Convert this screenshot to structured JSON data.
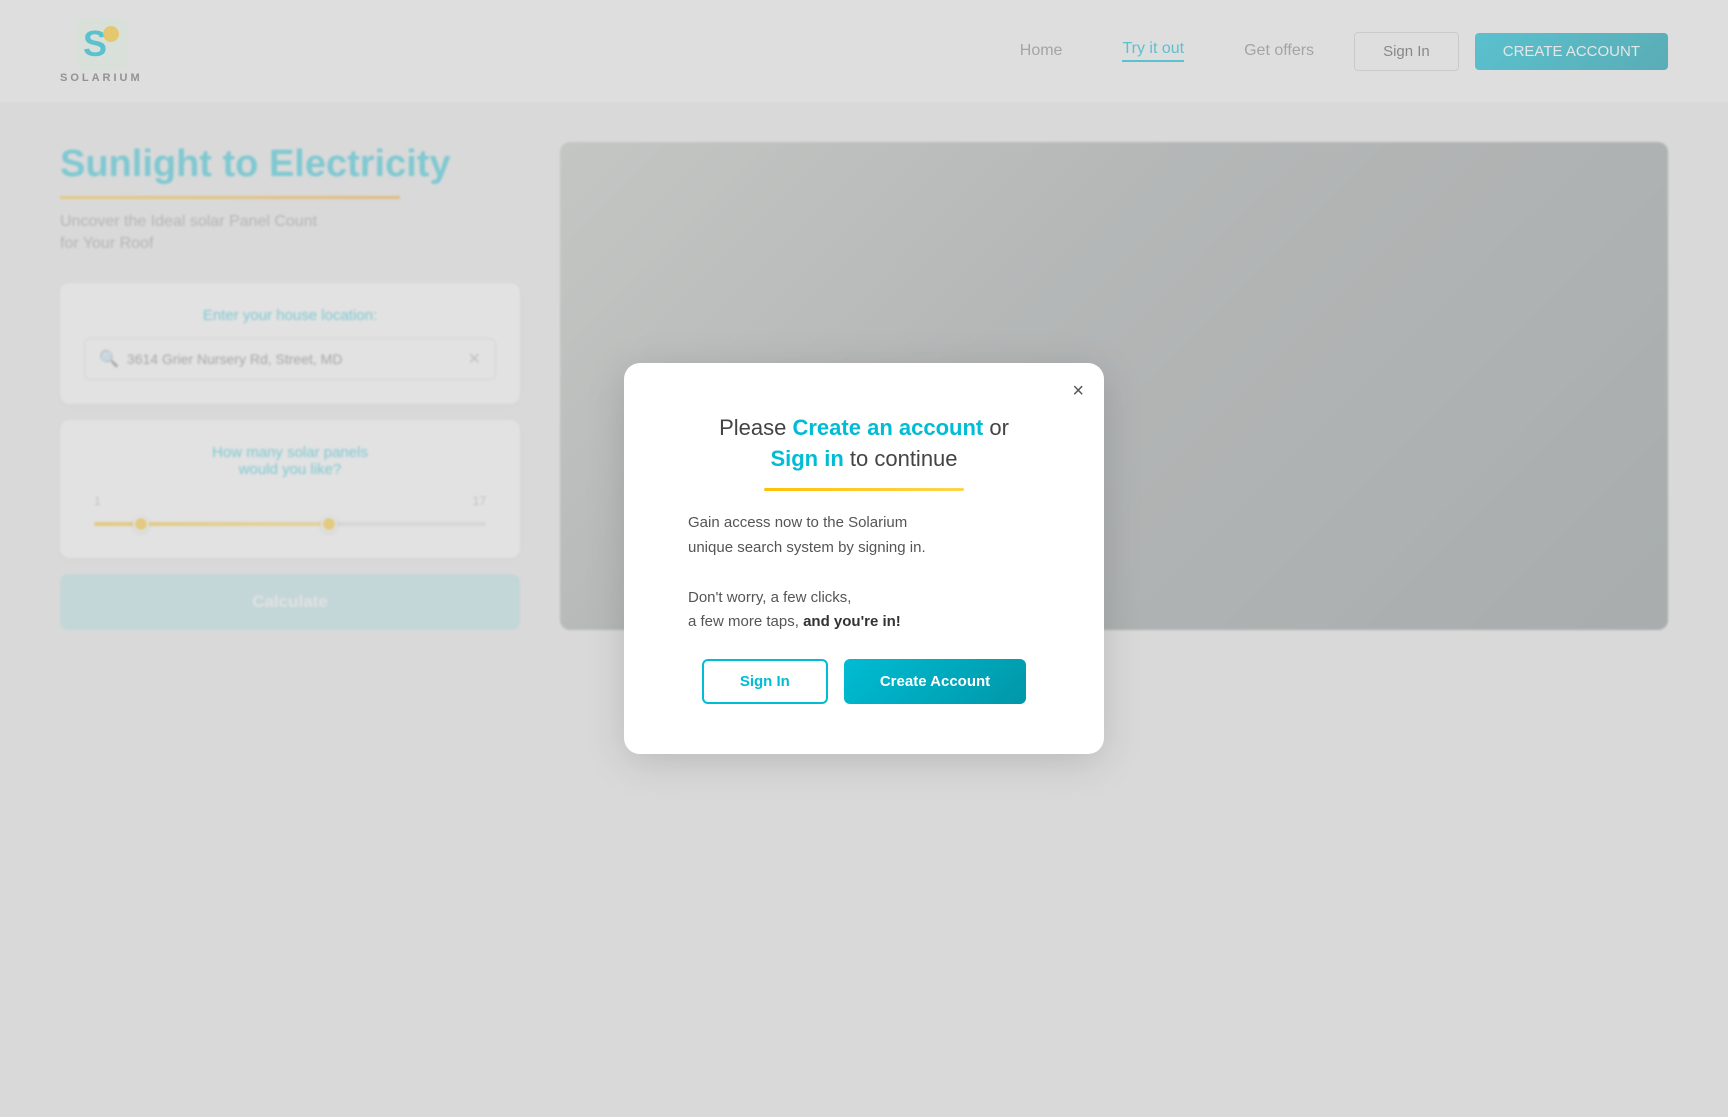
{
  "brand": {
    "name": "SOLARIUM"
  },
  "navbar": {
    "links": [
      {
        "label": "Home",
        "active": false
      },
      {
        "label": "Try it out",
        "active": true
      },
      {
        "label": "Get offers",
        "active": false
      }
    ],
    "signin_label": "Sign In",
    "create_account_label": "CREATE ACCOUNT"
  },
  "main": {
    "title": "Sunlight to Electricity",
    "subtitle": "Uncover the Ideal solar Panel Count\nfor Your Roof",
    "location_label": "Enter your house location:",
    "location_value": "3614 Grier Nursery Rd, Street, MD",
    "panels_label": "How many solar panels\nwould you like?",
    "slider_min": "1",
    "slider_max": "17",
    "calculate_label": "Calculate"
  },
  "modal": {
    "title_prefix": "Please ",
    "title_highlight": "Create an account",
    "title_middle": " or ",
    "title_signin": "Sign in",
    "title_suffix": " to continue",
    "body_line1": "Gain access now to the Solarium\nunique search system by signing in.",
    "body_line2": "Don't worry, a few clicks,\na few more taps, ",
    "body_bold": "and you're in!",
    "signin_label": "Sign In",
    "create_label": "Create Account",
    "close_icon": "×"
  }
}
